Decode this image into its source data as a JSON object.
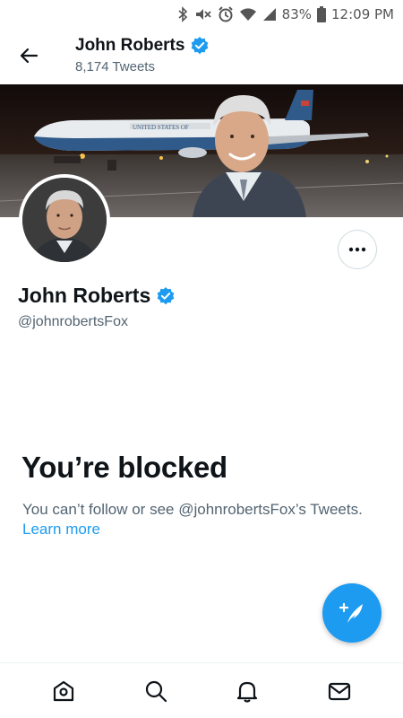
{
  "status_bar": {
    "battery_percent": "83%",
    "time": "12:09 PM"
  },
  "header": {
    "name": "John Roberts",
    "tweet_count": "8,174 Tweets"
  },
  "profile": {
    "name": "John Roberts",
    "handle": "@johnrobertsFox",
    "verified": true
  },
  "blocked": {
    "title": "You’re blocked",
    "message": "You can’t follow or see @johnrobertsFox’s Tweets.",
    "learn_more": "Learn more"
  },
  "banner": {
    "plane_text": "UNITED STATES OF"
  },
  "colors": {
    "accent": "#1d9bf0",
    "text": "#0f1419",
    "secondary": "#536471"
  },
  "icons": {
    "back": "arrow-left-icon",
    "verified": "verified-badge-icon",
    "more": "more-horizontal-icon",
    "compose": "compose-tweet-icon",
    "home": "home-icon",
    "search": "search-icon",
    "notifications": "bell-icon",
    "messages": "mail-icon"
  }
}
